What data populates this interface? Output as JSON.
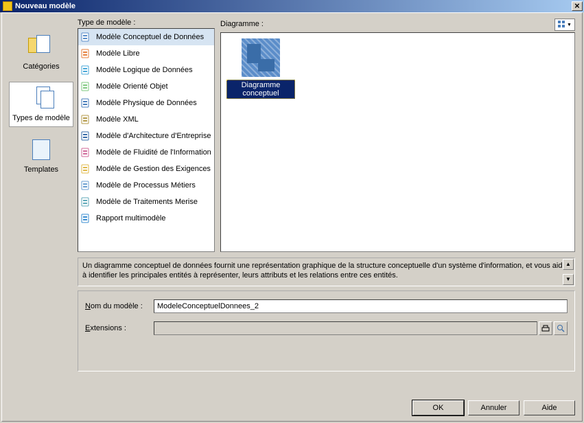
{
  "window": {
    "title": "Nouveau modèle"
  },
  "nav": {
    "items": [
      {
        "label": "Catégories"
      },
      {
        "label": "Types de modèle"
      },
      {
        "label": "Templates"
      }
    ]
  },
  "modelTypes": {
    "label": "Type de modèle :",
    "items": [
      "Modèle Conceptuel de Données",
      "Modèle Libre",
      "Modèle Logique de Données",
      "Modèle Orienté Objet",
      "Modèle Physique de Données",
      "Modèle XML",
      "Modèle d'Architecture d'Entreprise",
      "Modèle de Fluidité de l'Information",
      "Modèle de Gestion des Exigences",
      "Modèle de Processus Métiers",
      "Modèle de Traitements Merise",
      "Rapport multimodèle"
    ],
    "selectedIndex": 0
  },
  "diagrams": {
    "label": "Diagramme :",
    "items": [
      {
        "label": "Diagramme conceptuel"
      }
    ],
    "selectedIndex": 0
  },
  "description": "Un diagramme conceptuel de données fournit une représentation graphique de la structure conceptuelle d'un système d'information, et vous aide à identifier les principales entités à représenter, leurs attributs et les relations entre ces entités.",
  "form": {
    "nameLabel": "Nom du modèle :",
    "nameValue": "ModeleConceptuelDonnees_2",
    "extLabel": "Extensions :",
    "extValue": ""
  },
  "buttons": {
    "ok": "OK",
    "cancel": "Annuler",
    "help": "Aide"
  },
  "iconColors": [
    "#5b8dc9",
    "#e57f3c",
    "#4aa8d8",
    "#7fc97f",
    "#4a7ebb",
    "#b49a4a",
    "#3a6da8",
    "#d06a9a",
    "#e0b84a",
    "#6a9ed0",
    "#5fa8b8",
    "#3a8dd0"
  ]
}
